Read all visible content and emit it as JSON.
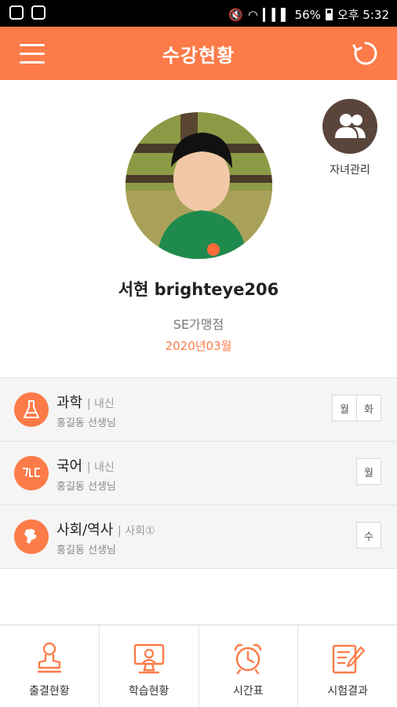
{
  "status_bar": {
    "battery": "56%",
    "time_label": "오후 5:32"
  },
  "header": {
    "title": "수강현황"
  },
  "profile": {
    "name": "서현 brighteye206",
    "branch": "SE가맹점",
    "month": "2020년03월",
    "children_label": "자녀관리"
  },
  "courses": [
    {
      "subject": "과학",
      "type": "| 내신",
      "teacher": "홍길동 선생님",
      "days": [
        "월",
        "화"
      ],
      "icon": "beaker-icon"
    },
    {
      "subject": "국어",
      "type": "| 내신",
      "teacher": "홍길동 선생님",
      "days": [
        "월"
      ],
      "icon": "hangul-icon"
    },
    {
      "subject": "사회/역사",
      "type": "| 사회①",
      "teacher": "홍길동 선생님",
      "days": [
        "수"
      ],
      "icon": "map-icon"
    }
  ],
  "bottom_nav": [
    {
      "label": "출결현황",
      "icon": "stamp-icon"
    },
    {
      "label": "학습현황",
      "icon": "monitor-icon"
    },
    {
      "label": "시간표",
      "icon": "alarm-clock-icon"
    },
    {
      "label": "시험결과",
      "icon": "test-paper-icon"
    }
  ],
  "colors": {
    "accent": "#fd7b48",
    "children_button": "#5a453b"
  }
}
